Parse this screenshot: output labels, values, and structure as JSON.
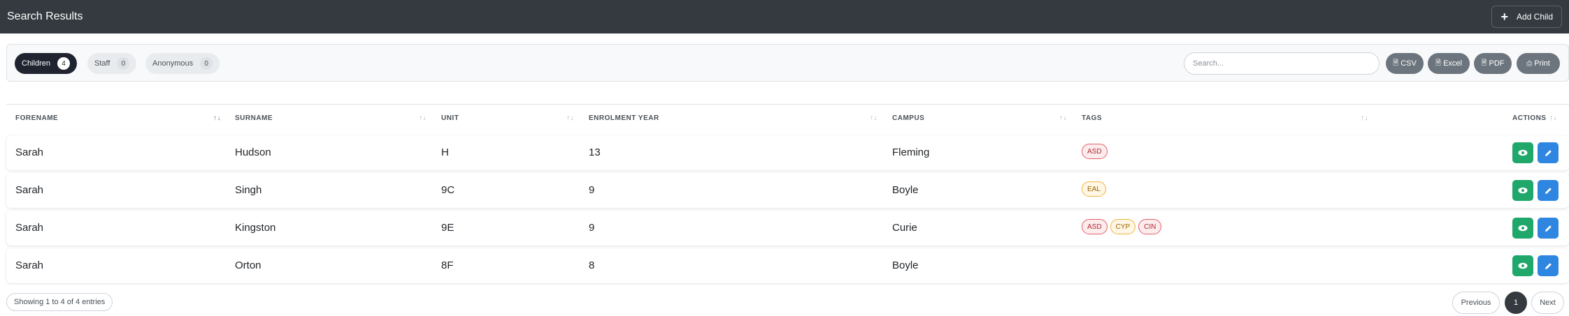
{
  "header": {
    "title": "Search Results",
    "add_child_label": "Add Child"
  },
  "filters": {
    "tabs": [
      {
        "label": "Children",
        "count": "4",
        "active": true
      },
      {
        "label": "Staff",
        "count": "0",
        "active": false
      },
      {
        "label": "Anonymous",
        "count": "0",
        "active": false
      }
    ],
    "search_placeholder": "Search...",
    "export_buttons": [
      "CSV",
      "Excel",
      "PDF",
      "Print"
    ]
  },
  "table": {
    "columns": [
      "FORENAME",
      "SURNAME",
      "UNIT",
      "ENROLMENT YEAR",
      "CAMPUS",
      "TAGS",
      "ACTIONS"
    ],
    "rows": [
      {
        "forename": "Sarah",
        "surname": "Hudson",
        "unit": "H",
        "year": "13",
        "campus": "Fleming",
        "tags": [
          "ASD"
        ]
      },
      {
        "forename": "Sarah",
        "surname": "Singh",
        "unit": "9C",
        "year": "9",
        "campus": "Boyle",
        "tags": [
          "EAL"
        ]
      },
      {
        "forename": "Sarah",
        "surname": "Kingston",
        "unit": "9E",
        "year": "9",
        "campus": "Curie",
        "tags": [
          "ASD",
          "CYP",
          "CIN"
        ]
      },
      {
        "forename": "Sarah",
        "surname": "Orton",
        "unit": "8F",
        "year": "8",
        "campus": "Boyle",
        "tags": []
      }
    ]
  },
  "footer": {
    "info": "Showing 1 to 4 of 4 entries",
    "previous_label": "Previous",
    "current_page": "1",
    "next_label": "Next"
  },
  "colors": {
    "header_bg": "#343a40",
    "view": "#20a86b",
    "edit": "#2f86e0",
    "tag_red": "#e35d6a",
    "tag_amber": "#f0b43c"
  }
}
